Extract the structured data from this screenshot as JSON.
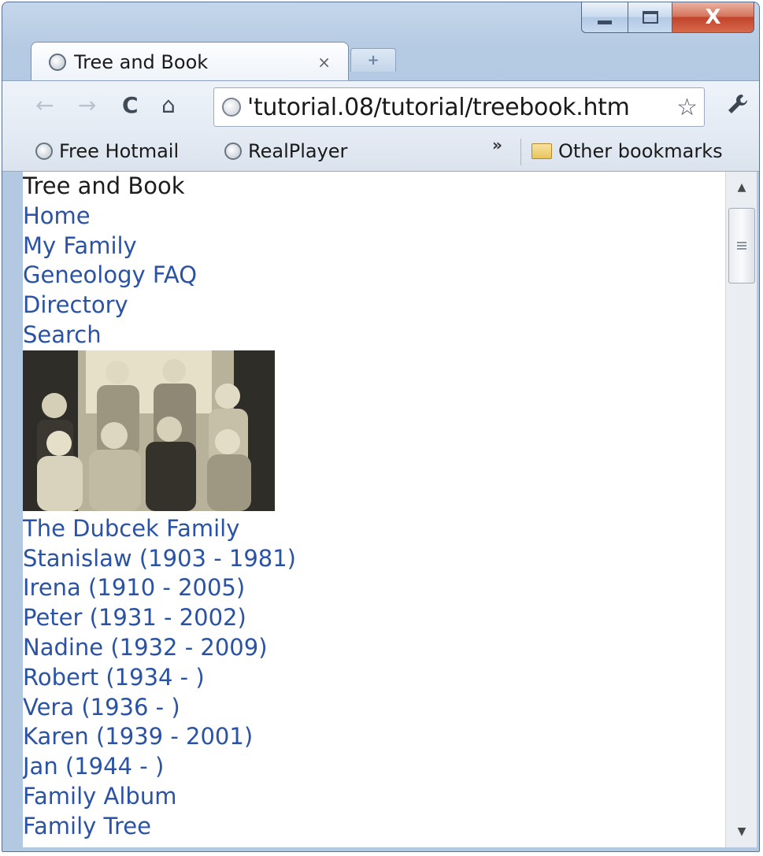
{
  "window": {
    "tab_title": "Tree and Book",
    "tab_close": "×",
    "new_tab": "+"
  },
  "toolbar": {
    "back": "←",
    "forward": "→",
    "reload": "C",
    "home": "⌂",
    "url": "'tutorial.08/tutorial/treebook.htm",
    "star": "☆",
    "wrench": "🔧"
  },
  "bookmarks": {
    "items": [
      "Free Hotmail",
      "RealPlayer"
    ],
    "chevron": "»",
    "other": "Other bookmarks"
  },
  "page": {
    "title": "Tree and Book",
    "nav": [
      "Home",
      "My Family",
      "Geneology FAQ",
      "Directory",
      "Search"
    ],
    "family_links": [
      "The Dubcek Family",
      "Stanislaw (1903 - 1981)",
      "Irena (1910 - 2005)",
      "Peter (1931 - 2002)",
      "Nadine (1932 - 2009)",
      "Robert (1934 - )",
      "Vera (1936 - )",
      "Karen (1939 - 2001)",
      "Jan (1944 - )",
      "Family Album",
      "Family Tree"
    ]
  },
  "colors": {
    "link": "#2a52a5",
    "text": "#1d1d1d",
    "chrome": "#b5cae3"
  },
  "icons": {
    "tab": "globe-icon",
    "omnibox": "globe-icon",
    "bookmark": "globe-icon",
    "folder": "folder-icon",
    "star": "star-icon",
    "wrench": "wrench-icon"
  }
}
